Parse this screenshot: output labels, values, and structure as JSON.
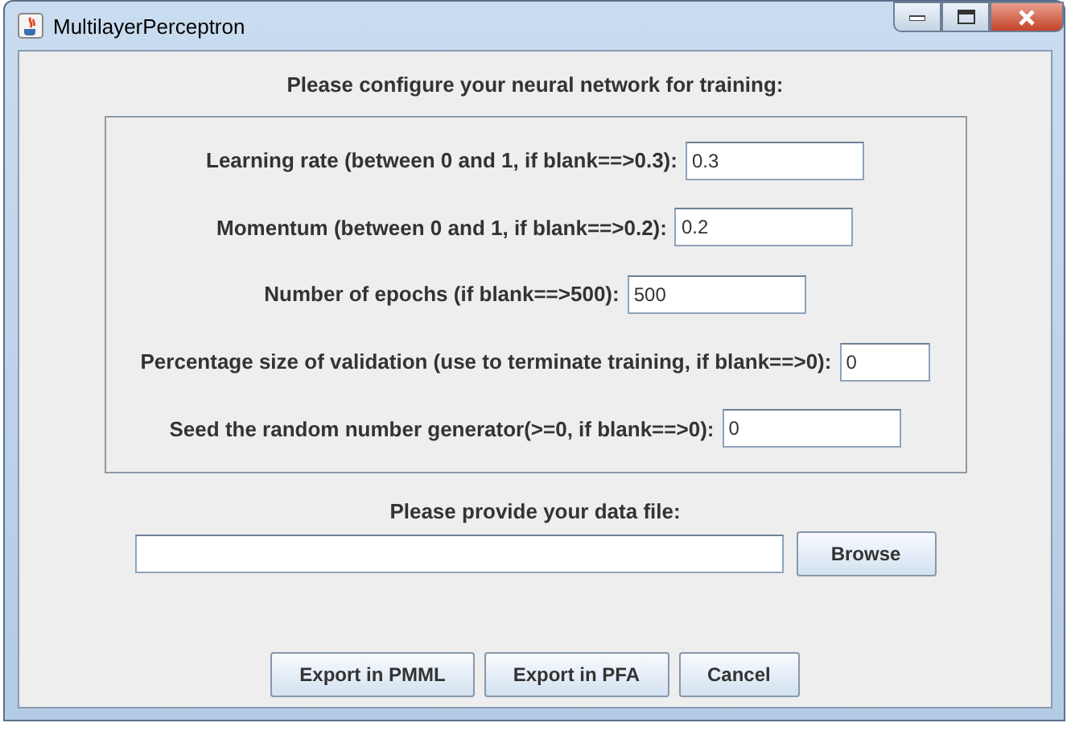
{
  "window": {
    "title": "MultilayerPerceptron"
  },
  "heading": "Please configure your neural network for training:",
  "params": [
    {
      "label": "Learning rate (between 0 and 1, if blank==>0.3):",
      "value": "0.3"
    },
    {
      "label": "Momentum (between 0 and 1, if blank==>0.2):",
      "value": "0.2"
    },
    {
      "label": "Number of epochs (if blank==>500):",
      "value": "500"
    },
    {
      "label": "Percentage size of validation (use to terminate training, if blank==>0):",
      "value": "0"
    },
    {
      "label": "Seed the random number generator(>=0, if blank==>0):",
      "value": "0"
    }
  ],
  "data_file": {
    "label": "Please provide your data file:",
    "browse": "Browse"
  },
  "buttons": [
    "Export in PMML",
    "Export in PFA",
    "Cancel"
  ]
}
